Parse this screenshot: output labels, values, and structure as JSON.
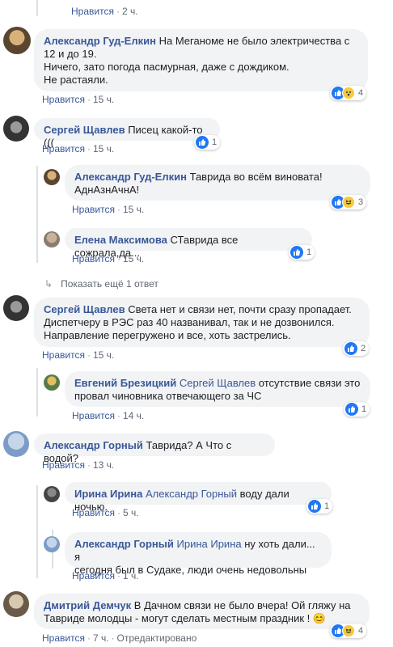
{
  "actions": {
    "like": "Нравится",
    "sep": "·",
    "edited": "Отредактировано"
  },
  "comments": [
    {
      "time": "2 ч."
    },
    {
      "author": "Александр Гуд-Елкин",
      "text": "На Меганоме не было электричества с 12 и до 19.",
      "text2": "Ничего, зато погода пасмурная, даже с дождиком.",
      "text3": "Не растаяли.",
      "time": "15 ч.",
      "reactions": "4"
    },
    {
      "author": "Сергей Щавлев",
      "text": "Писец какой-то (((",
      "time": "15 ч.",
      "reactions": "1"
    },
    {
      "author": "Александр Гуд-Елкин",
      "text": "Таврида во всём виновата!",
      "text2": "АднАзнАчнА!",
      "time": "15 ч.",
      "reactions": "3"
    },
    {
      "author": "Елена Максимова",
      "text": "СТаврида все сожрала,да...",
      "time": "15 ч.",
      "reactions": "1"
    },
    {
      "author": "Сергей Щавлев",
      "text": "Света нет и связи нет, почти сразу пропадает.",
      "text2": "Диспетчеру в РЭС раз 40 названивал, так и не дозвонился.",
      "text3": "Направление перегружено и все, хоть застрелись.",
      "time": "15 ч.",
      "reactions": "2"
    },
    {
      "author": "Евгений Брезицкий",
      "tag": "Сергей Щавлев",
      "text": "отсутствие связи это",
      "text2": "провал чиновника отвечающего за ЧС",
      "time": "14 ч.",
      "reactions": "1"
    },
    {
      "author": "Александр Горный",
      "text": "Таврида? А Что с водой?",
      "time": "13 ч."
    },
    {
      "author": "Ирина Ирина",
      "tag": "Александр Горный",
      "text": "воду дали ночью.",
      "time": "5 ч.",
      "reactions": "1"
    },
    {
      "author": "Александр Горный",
      "tag": "Ирина Ирина",
      "text": "ну хоть дали... я",
      "text2": "сегодня был в Судаке, люди очень недовольны",
      "time": "1 ч."
    },
    {
      "author": "Дмитрий Демчук",
      "text": "В Дачном связи не было вчера! Ой гляжу на",
      "text2": "Тавриде молодцы - могут сделать местным праздник ! 😊",
      "time": "7 ч.",
      "reactions": "4"
    }
  ],
  "show_more": "Показать ещё 1 ответ",
  "colors": {
    "link": "#385898",
    "bubble": "#f2f3f5",
    "like_blue": "#2078f4",
    "haha_yellow": "#f7c93b"
  }
}
